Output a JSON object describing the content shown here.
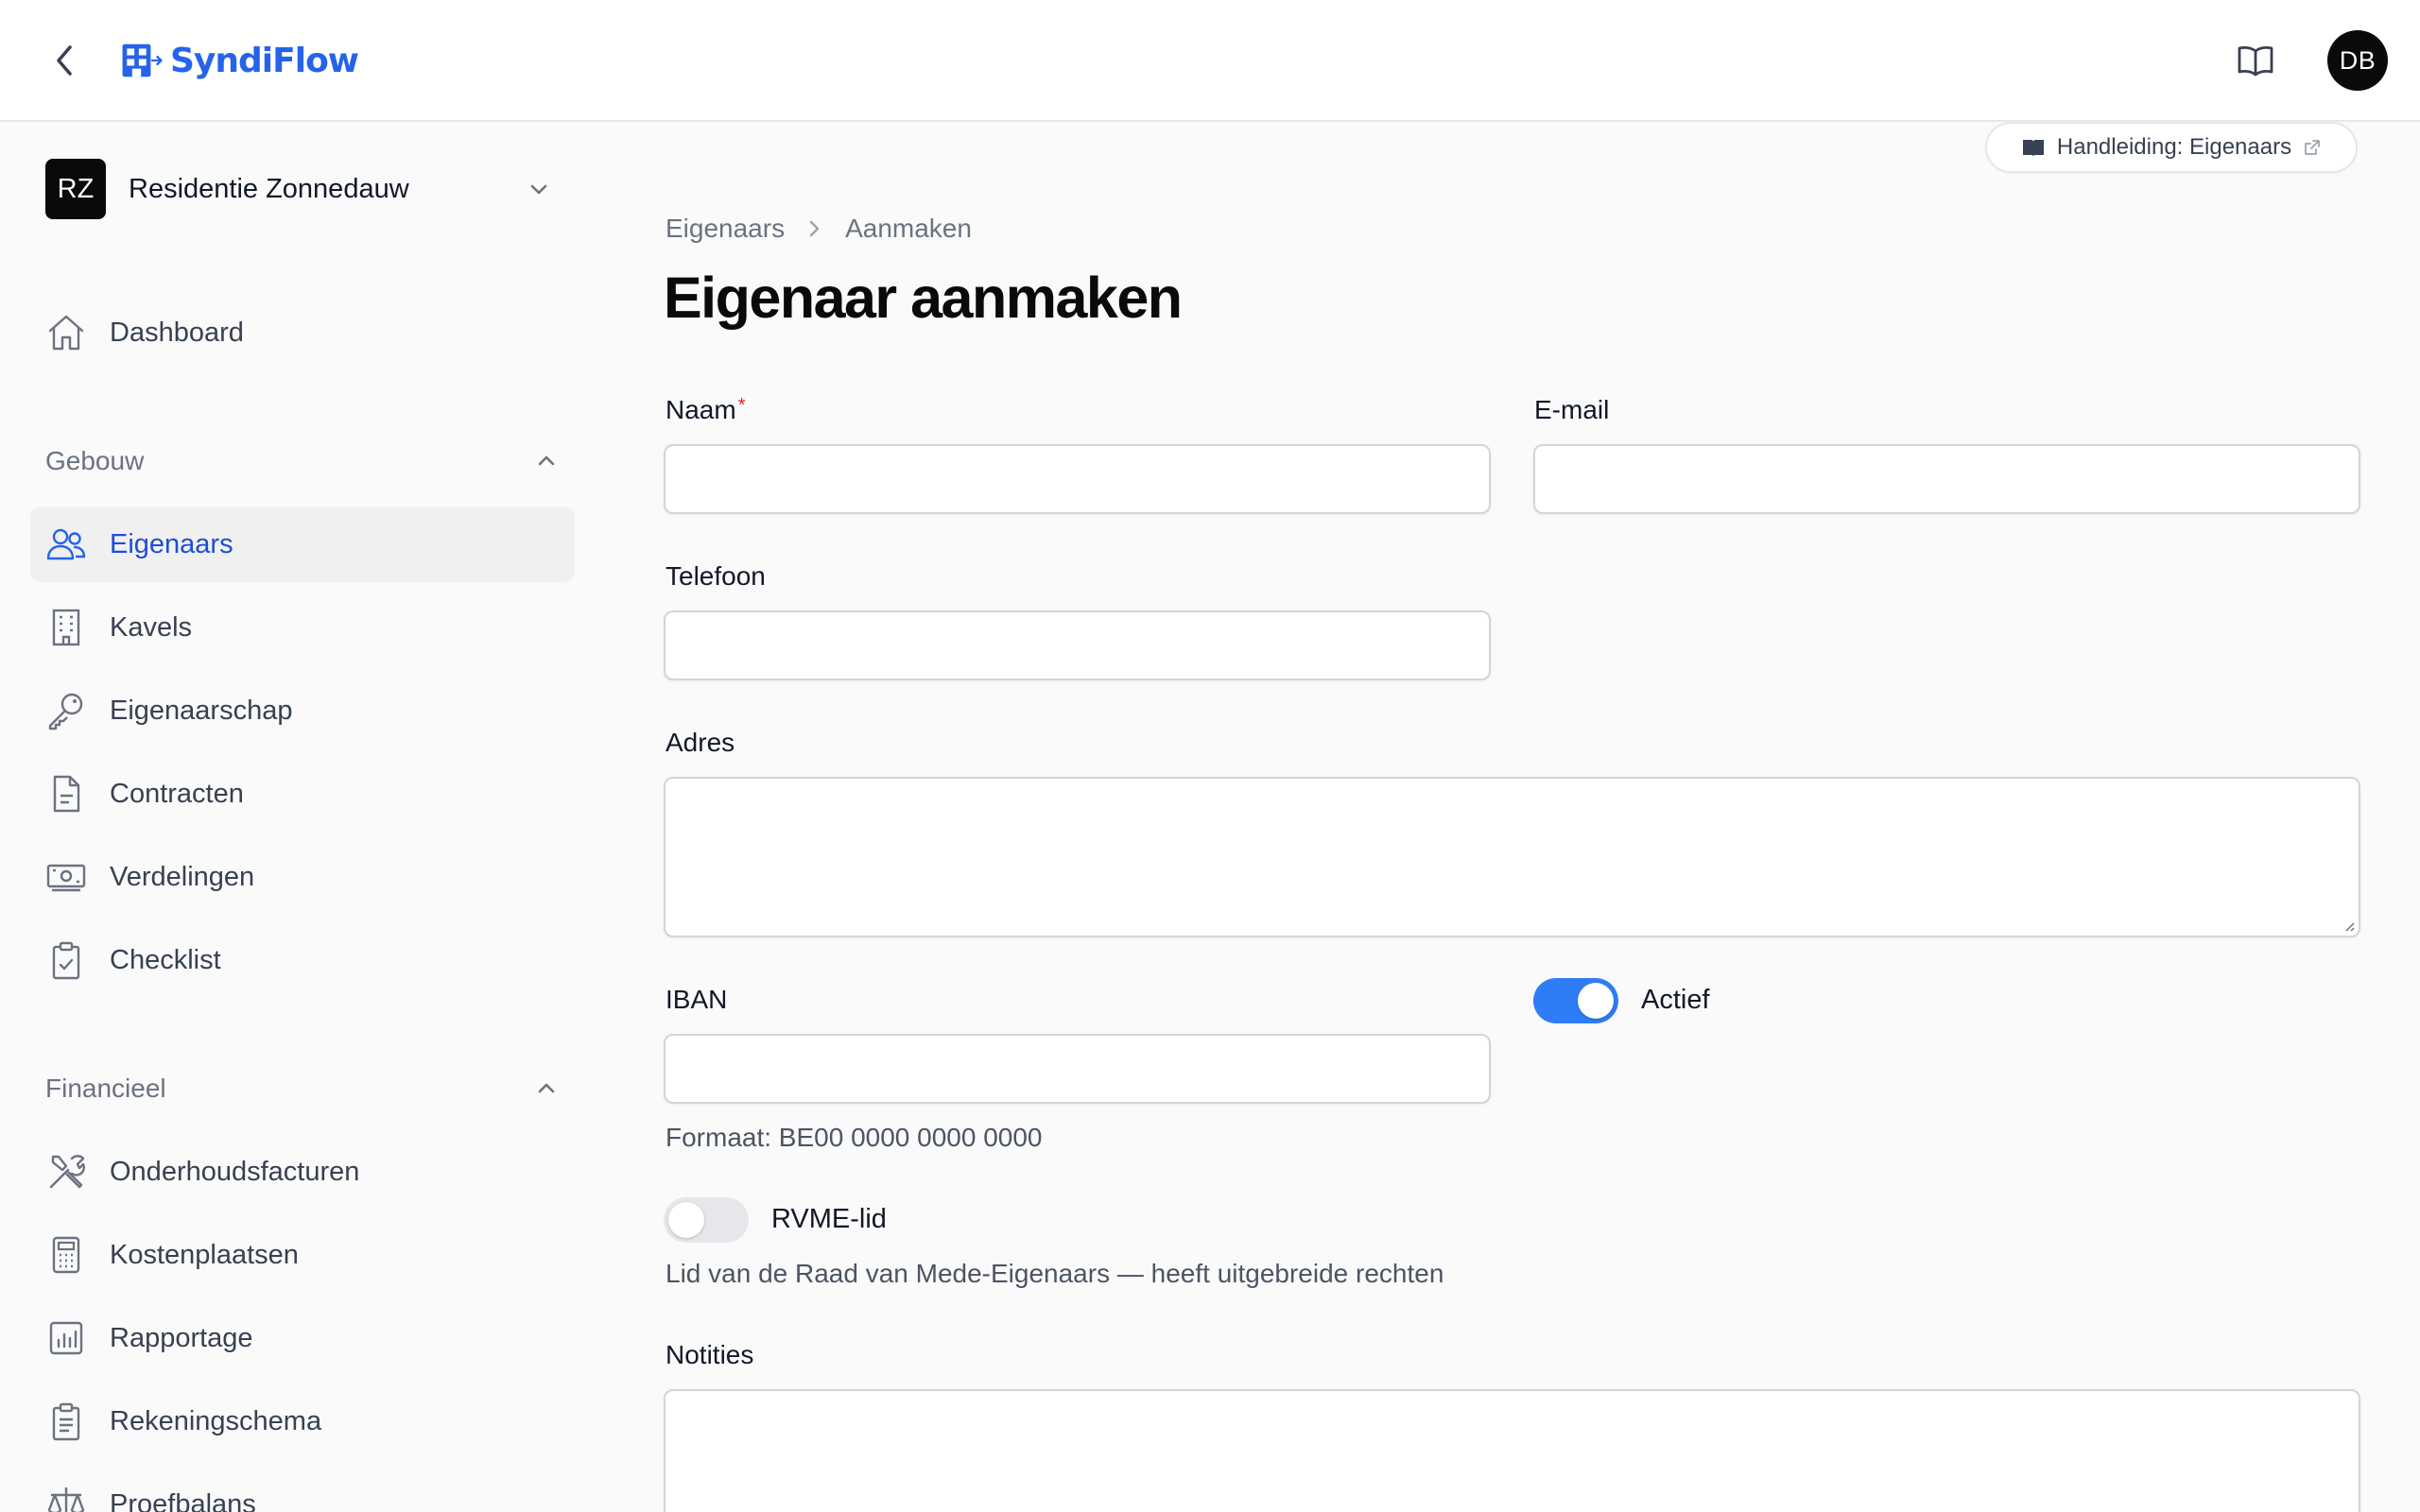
{
  "app": {
    "name": "SyndiFlow",
    "brand_color": "#2563eb"
  },
  "header": {
    "user_initials": "DB"
  },
  "org": {
    "initials": "RZ",
    "name": "Residentie Zonnedauw"
  },
  "sidebar": {
    "dashboard": {
      "label": "Dashboard",
      "icon": "home-icon"
    },
    "sections": [
      {
        "label": "Gebouw",
        "items": [
          {
            "label": "Eigenaars",
            "icon": "users-icon",
            "active": true
          },
          {
            "label": "Kavels",
            "icon": "building-icon"
          },
          {
            "label": "Eigenaarschap",
            "icon": "key-icon"
          },
          {
            "label": "Contracten",
            "icon": "document-icon"
          },
          {
            "label": "Verdelingen",
            "icon": "banknote-icon"
          },
          {
            "label": "Checklist",
            "icon": "clipboard-check-icon"
          }
        ]
      },
      {
        "label": "Financieel",
        "items": [
          {
            "label": "Onderhoudsfacturen",
            "icon": "tools-icon"
          },
          {
            "label": "Kostenplaatsen",
            "icon": "calculator-icon"
          },
          {
            "label": "Rapportage",
            "icon": "chart-icon"
          },
          {
            "label": "Rekeningschema",
            "icon": "clipboard-list-icon"
          },
          {
            "label": "Proefbalans",
            "icon": "scale-icon"
          }
        ]
      }
    ]
  },
  "guide": {
    "label": "Handleiding: Eigenaars"
  },
  "breadcrumb": {
    "parent": "Eigenaars",
    "current": "Aanmaken"
  },
  "page": {
    "title": "Eigenaar aanmaken"
  },
  "form": {
    "naam": {
      "label": "Naam",
      "required_mark": "*",
      "value": ""
    },
    "email": {
      "label": "E-mail",
      "value": ""
    },
    "telefoon": {
      "label": "Telefoon",
      "value": ""
    },
    "adres": {
      "label": "Adres",
      "value": ""
    },
    "iban": {
      "label": "IBAN",
      "value": "",
      "helper": "Formaat: BE00 0000 0000 0000"
    },
    "actief": {
      "label": "Actief",
      "checked": true
    },
    "rvme": {
      "label": "RVME-lid",
      "checked": false,
      "helper": "Lid van de Raad van Mede-Eigenaars — heeft uitgebreide rechten"
    },
    "notities": {
      "label": "Notities",
      "value": ""
    }
  },
  "colors": {
    "accent": "#2f7df6",
    "active_nav_text": "#1d4ed8",
    "required": "#dc2626"
  }
}
